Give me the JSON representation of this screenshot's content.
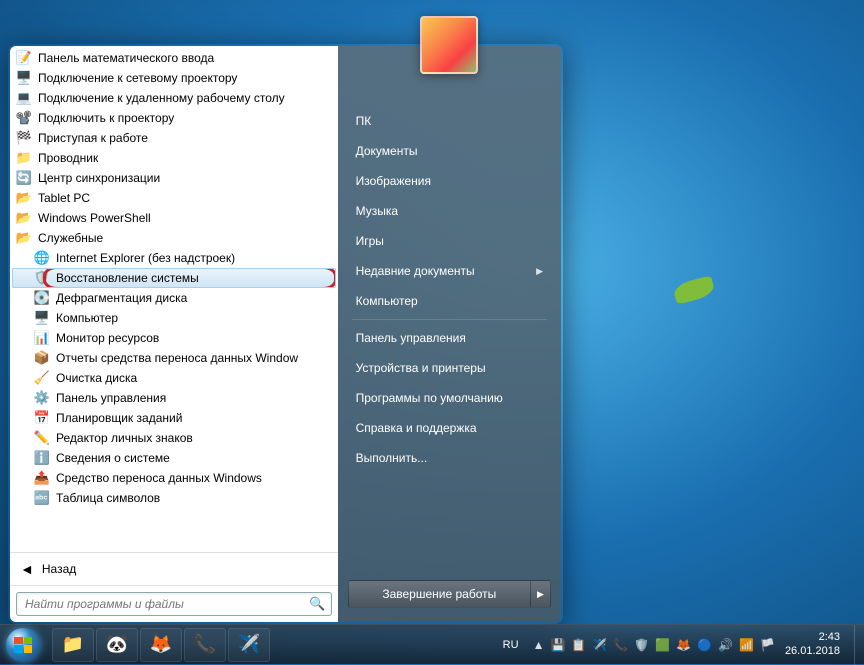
{
  "programs": [
    {
      "icon": "📝",
      "label": "Панель математического ввода",
      "indent": 0
    },
    {
      "icon": "🖥️",
      "label": "Подключение к сетевому проектору",
      "indent": 0
    },
    {
      "icon": "💻",
      "label": "Подключение к удаленному рабочему столу",
      "indent": 0
    },
    {
      "icon": "📽️",
      "label": "Подключить к проектору",
      "indent": 0
    },
    {
      "icon": "🏁",
      "label": "Приступая к работе",
      "indent": 0
    },
    {
      "icon": "📁",
      "label": "Проводник",
      "indent": 0
    },
    {
      "icon": "🔄",
      "label": "Центр синхронизации",
      "indent": 0
    },
    {
      "icon": "📂",
      "label": "Tablet PC",
      "indent": 0,
      "folder": true
    },
    {
      "icon": "📂",
      "label": "Windows PowerShell",
      "indent": 0,
      "folder": true
    },
    {
      "icon": "📂",
      "label": "Служебные",
      "indent": 0,
      "folder": true
    },
    {
      "icon": "🌐",
      "label": "Internet Explorer (без надстроек)",
      "indent": 1
    },
    {
      "icon": "🛡️",
      "label": "Восстановление системы",
      "indent": 1,
      "highlighted": true
    },
    {
      "icon": "💽",
      "label": "Дефрагментация диска",
      "indent": 1
    },
    {
      "icon": "🖥️",
      "label": "Компьютер",
      "indent": 1
    },
    {
      "icon": "📊",
      "label": "Монитор ресурсов",
      "indent": 1
    },
    {
      "icon": "📦",
      "label": "Отчеты средства переноса данных Window",
      "indent": 1
    },
    {
      "icon": "🧹",
      "label": "Очистка диска",
      "indent": 1
    },
    {
      "icon": "⚙️",
      "label": "Панель управления",
      "indent": 1
    },
    {
      "icon": "📅",
      "label": "Планировщик заданий",
      "indent": 1
    },
    {
      "icon": "✏️",
      "label": "Редактор личных знаков",
      "indent": 1
    },
    {
      "icon": "ℹ️",
      "label": "Сведения о системе",
      "indent": 1
    },
    {
      "icon": "📤",
      "label": "Средство переноса данных Windows",
      "indent": 1
    },
    {
      "icon": "🔤",
      "label": "Таблица символов",
      "indent": 1
    }
  ],
  "back_label": "Назад",
  "search": {
    "placeholder": "Найти программы и файлы"
  },
  "right_items": [
    {
      "label": "ПК"
    },
    {
      "label": "Документы"
    },
    {
      "label": "Изображения"
    },
    {
      "label": "Музыка"
    },
    {
      "label": "Игры"
    },
    {
      "label": "Недавние документы",
      "submenu": true
    },
    {
      "label": "Компьютер"
    },
    {
      "sep": true
    },
    {
      "label": "Панель управления"
    },
    {
      "label": "Устройства и принтеры"
    },
    {
      "label": "Программы по умолчанию"
    },
    {
      "label": "Справка и поддержка"
    },
    {
      "label": "Выполнить..."
    }
  ],
  "shutdown_label": "Завершение работы",
  "taskbar": {
    "lang": "RU",
    "time": "2:43",
    "date": "26.01.2018"
  },
  "tb_apps": [
    "📁",
    "🐼",
    "🦊",
    "📞",
    "✈️"
  ],
  "tray_icons": [
    "▲",
    "💾",
    "📋",
    "✈️",
    "📞",
    "🛡️",
    "🟩",
    "🦊",
    "🔵",
    "🔊",
    "📶",
    "🏳️"
  ]
}
